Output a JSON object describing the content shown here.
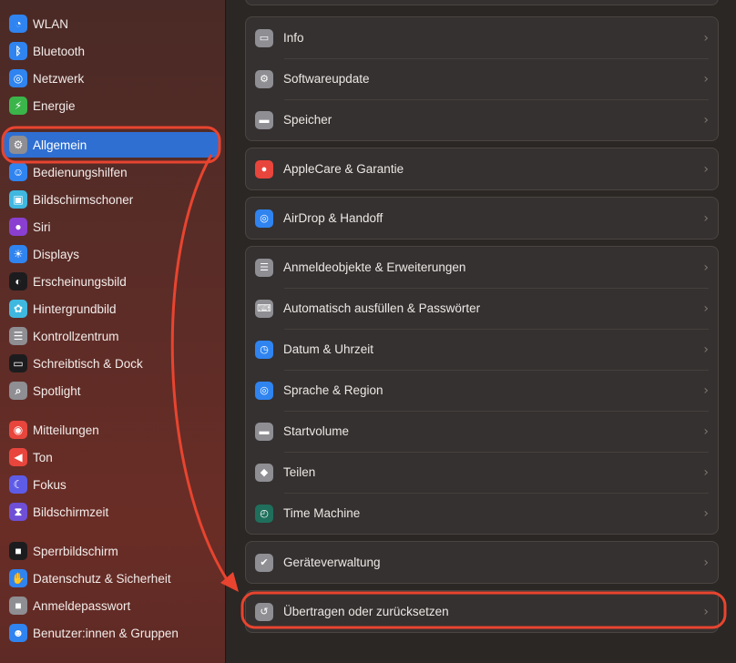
{
  "sidebar": {
    "items": [
      {
        "label": "WLAN",
        "icon": "wifi-icon",
        "color": "#2f84f0",
        "glyph": "◔"
      },
      {
        "label": "Bluetooth",
        "icon": "bluetooth-icon",
        "color": "#2f84f0",
        "glyph": "ᛒ"
      },
      {
        "label": "Netzwerk",
        "icon": "globe-icon",
        "color": "#2f84f0",
        "glyph": "◎"
      },
      {
        "label": "Energie",
        "icon": "bolt-icon",
        "color": "#3bb54a",
        "glyph": "⚡"
      },
      {
        "label": "Allgemein",
        "icon": "gear-icon",
        "color": "#8e8e93",
        "glyph": "⚙"
      },
      {
        "label": "Bedienungshilfen",
        "icon": "accessibility-icon",
        "color": "#2f84f0",
        "glyph": "☺"
      },
      {
        "label": "Bildschirmschoner",
        "icon": "screensaver-icon",
        "color": "#3fb8e0",
        "glyph": "▣"
      },
      {
        "label": "Siri",
        "icon": "siri-icon",
        "color": "#8a3fd0",
        "glyph": "●"
      },
      {
        "label": "Displays",
        "icon": "sun-icon",
        "color": "#2f84f0",
        "glyph": "☀"
      },
      {
        "label": "Erscheinungsbild",
        "icon": "appearance-icon",
        "color": "#1c1c1e",
        "glyph": "◐"
      },
      {
        "label": "Hintergrundbild",
        "icon": "flower-icon",
        "color": "#3fb8e0",
        "glyph": "✿"
      },
      {
        "label": "Kontrollzentrum",
        "icon": "toggles-icon",
        "color": "#8e8e93",
        "glyph": "☰"
      },
      {
        "label": "Schreibtisch & Dock",
        "icon": "dock-icon",
        "color": "#1c1c1e",
        "glyph": "▭"
      },
      {
        "label": "Spotlight",
        "icon": "magnifier-icon",
        "color": "#8e8e93",
        "glyph": "⌕"
      },
      {
        "label": "Mitteilungen",
        "icon": "bell-icon",
        "color": "#e8453c",
        "glyph": "◉"
      },
      {
        "label": "Ton",
        "icon": "speaker-icon",
        "color": "#e8453c",
        "glyph": "◀"
      },
      {
        "label": "Fokus",
        "icon": "moon-icon",
        "color": "#5e5ce6",
        "glyph": "☾"
      },
      {
        "label": "Bildschirmzeit",
        "icon": "hourglass-icon",
        "color": "#6e4fd6",
        "glyph": "⧗"
      },
      {
        "label": "Sperrbildschirm",
        "icon": "lock-icon",
        "color": "#1c1c1e",
        "glyph": "■"
      },
      {
        "label": "Datenschutz & Sicherheit",
        "icon": "hand-icon",
        "color": "#2f84f0",
        "glyph": "✋"
      },
      {
        "label": "Anmeldepasswort",
        "icon": "lock-icon",
        "color": "#8e8e93",
        "glyph": "■"
      },
      {
        "label": "Benutzer:innen & Gruppen",
        "icon": "users-icon",
        "color": "#2f84f0",
        "glyph": "☻"
      }
    ]
  },
  "main": {
    "groups": [
      {
        "rows": [
          {
            "label": "Info",
            "icon": "info-icon",
            "color": "#8e8e93",
            "glyph": "▭"
          },
          {
            "label": "Softwareupdate",
            "icon": "softwareupdate-icon",
            "color": "#8e8e93",
            "glyph": "⚙"
          },
          {
            "label": "Speicher",
            "icon": "storage-icon",
            "color": "#8e8e93",
            "glyph": "▬"
          }
        ]
      },
      {
        "rows": [
          {
            "label": "AppleCare & Garantie",
            "icon": "apple-icon",
            "color": "#e8453c",
            "glyph": "●"
          }
        ]
      },
      {
        "rows": [
          {
            "label": "AirDrop & Handoff",
            "icon": "airdrop-icon",
            "color": "#2f84f0",
            "glyph": "◎"
          }
        ]
      },
      {
        "rows": [
          {
            "label": "Anmeldeobjekte & Erweiterungen",
            "icon": "list-icon",
            "color": "#8e8e93",
            "glyph": "☰"
          },
          {
            "label": "Automatisch ausfüllen & Passwörter",
            "icon": "keyboard-icon",
            "color": "#8e8e93",
            "glyph": "⌨"
          },
          {
            "label": "Datum & Uhrzeit",
            "icon": "calendar-clock-icon",
            "color": "#2f84f0",
            "glyph": "◷"
          },
          {
            "label": "Sprache & Region",
            "icon": "globe-icon",
            "color": "#2f84f0",
            "glyph": "◎"
          },
          {
            "label": "Startvolume",
            "icon": "disk-icon",
            "color": "#8e8e93",
            "glyph": "▬"
          },
          {
            "label": "Teilen",
            "icon": "sharing-icon",
            "color": "#8e8e93",
            "glyph": "◆"
          },
          {
            "label": "Time Machine",
            "icon": "timemachine-icon",
            "color": "#1f6f5c",
            "glyph": "◴"
          }
        ]
      },
      {
        "rows": [
          {
            "label": "Geräteverwaltung",
            "icon": "shield-check-icon",
            "color": "#8e8e93",
            "glyph": "✔"
          }
        ]
      },
      {
        "rows": [
          {
            "label": "Übertragen oder zurücksetzen",
            "icon": "reset-icon",
            "color": "#8e8e93",
            "glyph": "↺"
          }
        ]
      }
    ]
  },
  "annotation": {
    "color": "#e8442f"
  }
}
